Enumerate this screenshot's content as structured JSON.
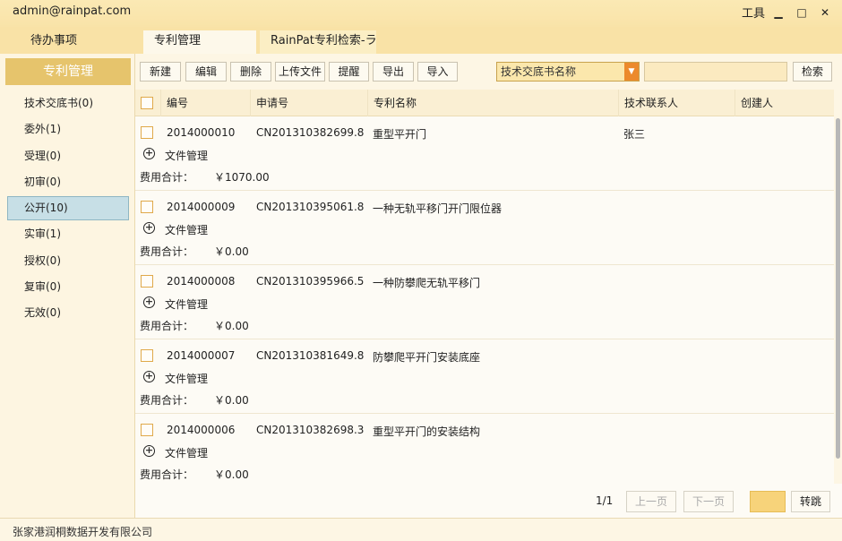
{
  "titlebar": {
    "user": "admin@rainpat.com",
    "tools": "工具",
    "minimize": "▁",
    "maximize": "□",
    "close": "✕"
  },
  "tabs": [
    "待办事项",
    "专利管理",
    "RainPat专利检索-ラ"
  ],
  "sidebar": {
    "header": "专利管理",
    "items": [
      "技术交底书(0)",
      "委外(1)",
      "受理(0)",
      "初审(0)",
      "公开(10)",
      "实审(1)",
      "授权(0)",
      "复审(0)",
      "无效(0)"
    ]
  },
  "toolbar": {
    "buttons": [
      "新建",
      "编辑",
      "删除",
      "上传文件",
      "提醒",
      "导出",
      "导入"
    ],
    "search_type": "技术交底书名称",
    "search_value": "",
    "search_button": "检索"
  },
  "table": {
    "columns": [
      "编号",
      "申请号",
      "专利名称",
      "技术联系人",
      "创建人"
    ],
    "file_label": "文件管理",
    "fee_label": "费用合计：",
    "rows": [
      {
        "id": "2014000010",
        "app_no": "CN201310382699.8",
        "name": "重型平开门",
        "contact": "张三",
        "creator": "",
        "fee": "￥1070.00"
      },
      {
        "id": "2014000009",
        "app_no": "CN201310395061.8",
        "name": "一种无轨平移门开门限位器",
        "contact": "",
        "creator": "",
        "fee": "￥0.00"
      },
      {
        "id": "2014000008",
        "app_no": "CN201310395966.5",
        "name": "一种防攀爬无轨平移门",
        "contact": "",
        "creator": "",
        "fee": "￥0.00"
      },
      {
        "id": "2014000007",
        "app_no": "CN201310381649.8",
        "name": "防攀爬平开门安装底座",
        "contact": "",
        "creator": "",
        "fee": "￥0.00"
      },
      {
        "id": "2014000006",
        "app_no": "CN201310382698.3",
        "name": "重型平开门的安装结构",
        "contact": "",
        "creator": "",
        "fee": "￥0.00"
      }
    ]
  },
  "pager": {
    "page_info": "1/1",
    "prev": "上一页",
    "next": "下一页",
    "jump": "转跳"
  },
  "status": {
    "company": "张家港润桐数据开发有限公司"
  }
}
